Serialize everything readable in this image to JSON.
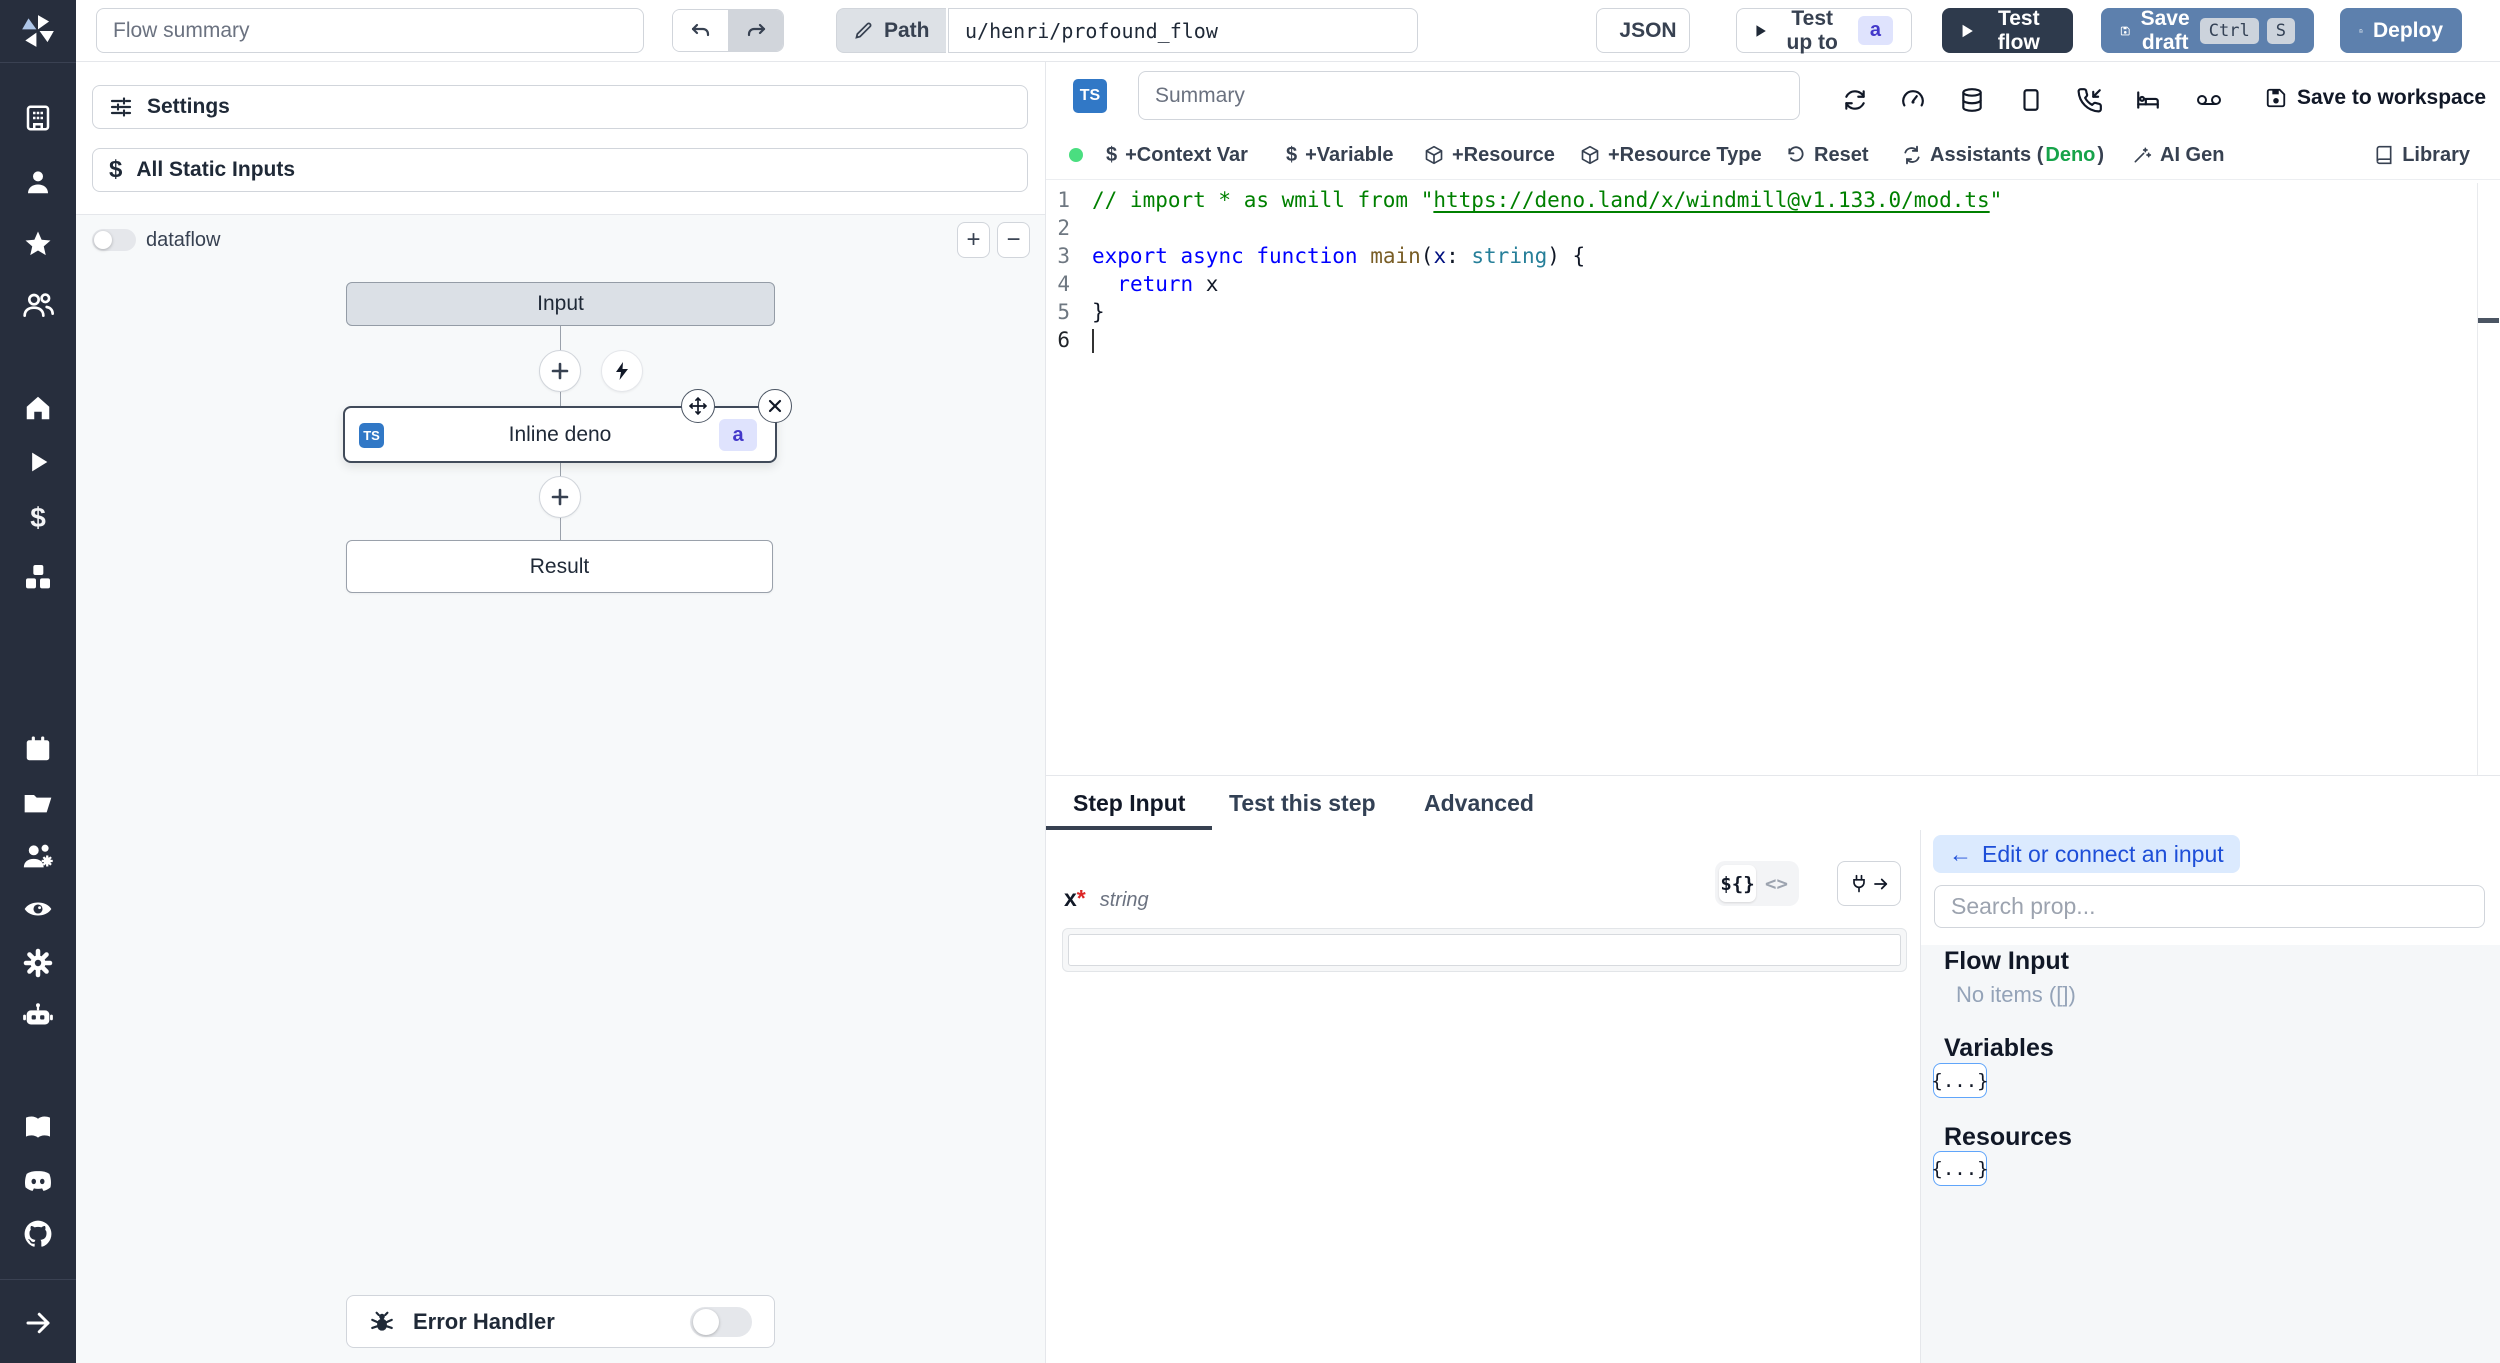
{
  "colors": {
    "sidebar_bg": "#272e3d",
    "primary_button": "#5d80ad",
    "dark_button": "#2e3a4c",
    "badge_indigo_bg": "#dfe3fd",
    "badge_indigo_text": "#4338ca",
    "edit_button_bg": "#dbeafe",
    "edit_button_text": "#1d4ed8",
    "deno_green": "#16a34a",
    "status_dot_green": "#4ade80",
    "comment_green": "#008000",
    "keyword_blue": "#0000ff"
  },
  "sidebar": {
    "logo": "windmill-logo",
    "icons": [
      "building",
      "user",
      "star",
      "users",
      "home",
      "play",
      "dollar",
      "cubes",
      "calendar",
      "folder",
      "user-cog",
      "eye",
      "settings-gear",
      "robot",
      "book",
      "discord",
      "github",
      "arrow-right"
    ]
  },
  "topbar": {
    "flow_summary_placeholder": "Flow summary",
    "path_label": "Path",
    "path_value": "u/henri/profound_flow",
    "json_button": "JSON",
    "test_up_to_label": "Test up to",
    "test_up_to_badge": "a",
    "test_flow_label": "Test flow",
    "save_draft_label": "Save draft",
    "shortcut_ctrl": "Ctrl",
    "shortcut_s": "S",
    "deploy_label": "Deploy"
  },
  "flow_panel": {
    "settings_label": "Settings",
    "static_inputs_label": "All Static Inputs",
    "dataflow_label": "dataflow",
    "zoom_in": "+",
    "zoom_out": "−",
    "nodes": {
      "input_label": "Input",
      "step_label": "Inline deno",
      "step_lang_badge": "TS",
      "step_id_badge": "a",
      "result_label": "Result"
    },
    "error_handler_label": "Error Handler"
  },
  "editor": {
    "lang_badge": "TS",
    "summary_placeholder": "Summary",
    "top_icons": [
      "cycle",
      "gauge",
      "database",
      "rectangle",
      "phone-incoming",
      "bed",
      "voicemail"
    ],
    "save_to_workspace_label": "Save to workspace",
    "toolbar": {
      "context_var": "+Context Var",
      "variable": "+Variable",
      "resource": "+Resource",
      "resource_type": "+Resource Type",
      "reset": "Reset",
      "assistants_prefix": "Assistants (",
      "assistants_lang": "Deno",
      "assistants_suffix": ")",
      "ai_gen": "AI Gen",
      "library": "Library",
      "dollar": "$"
    },
    "code": {
      "lines": [
        {
          "n": 1,
          "segs": [
            {
              "t": "// import * as wmill from \"",
              "c": "cmt"
            },
            {
              "t": "https://deno.land/x/windmill@v1.133.0/mod.ts",
              "c": "cmt link"
            },
            {
              "t": "\"",
              "c": "cmt"
            }
          ]
        },
        {
          "n": 2,
          "segs": []
        },
        {
          "n": 3,
          "segs": [
            {
              "t": "export",
              "c": "kw"
            },
            {
              "t": " ",
              "c": "pl"
            },
            {
              "t": "async",
              "c": "kw"
            },
            {
              "t": " ",
              "c": "pl"
            },
            {
              "t": "function",
              "c": "kw"
            },
            {
              "t": " ",
              "c": "pl"
            },
            {
              "t": "main",
              "c": "fn"
            },
            {
              "t": "(",
              "c": "pl"
            },
            {
              "t": "x",
              "c": "vr"
            },
            {
              "t": ": ",
              "c": "pl"
            },
            {
              "t": "string",
              "c": "ty"
            },
            {
              "t": ") {",
              "c": "pl"
            }
          ]
        },
        {
          "n": 4,
          "segs": [
            {
              "t": "  ",
              "c": "pl"
            },
            {
              "t": "return",
              "c": "kw"
            },
            {
              "t": " x",
              "c": "pl"
            }
          ]
        },
        {
          "n": 5,
          "segs": [
            {
              "t": "}",
              "c": "pl"
            }
          ]
        },
        {
          "n": 6,
          "segs": [],
          "cursor": true,
          "active": true
        }
      ]
    }
  },
  "bottom": {
    "tabs": [
      {
        "label": "Step Input",
        "active": true
      },
      {
        "label": "Test this step",
        "active": false
      },
      {
        "label": "Advanced",
        "active": false
      }
    ],
    "field": {
      "name": "x",
      "required_mark": "*",
      "type": "string",
      "value": ""
    },
    "editor_toggle": {
      "template": "${}",
      "code": "<>"
    }
  },
  "prop_panel": {
    "edit_button_arrow": "←",
    "edit_button_label": "Edit or connect an input",
    "search_placeholder": "Search prop...",
    "flow_input_title": "Flow Input",
    "flow_input_empty": "No items ([])",
    "variables_title": "Variables",
    "variables_chip": "{...}",
    "resources_title": "Resources",
    "resources_chip": "{...}"
  }
}
